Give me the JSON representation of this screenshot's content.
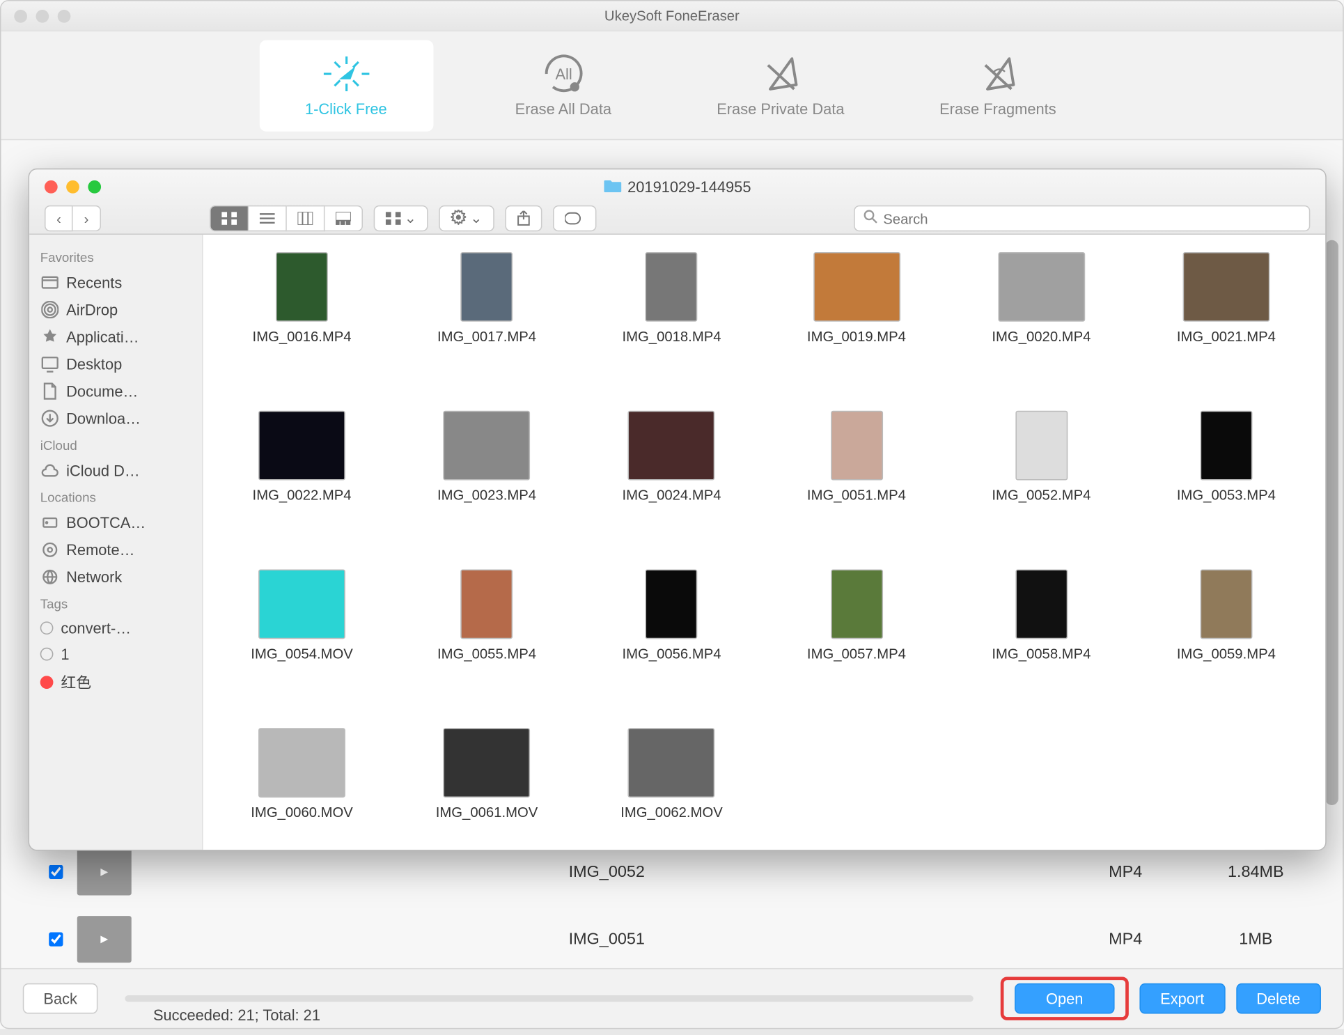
{
  "app": {
    "title": "UkeySoft FoneEraser",
    "tabs": [
      {
        "label": "1-Click Free",
        "active": true
      },
      {
        "label": "Erase All Data",
        "active": false
      },
      {
        "label": "Erase Private Data",
        "active": false
      },
      {
        "label": "Erase Fragments",
        "active": false
      }
    ]
  },
  "background_rows": [
    {
      "name": "IMG_0052",
      "type": "MP4",
      "size": "1.84MB"
    },
    {
      "name": "IMG_0051",
      "type": "MP4",
      "size": "1MB"
    }
  ],
  "bottom": {
    "back": "Back",
    "open": "Open",
    "export": "Export",
    "delete": "Delete",
    "status": "Succeeded: 21; Total: 21"
  },
  "finder": {
    "title": "20191029-144955",
    "search_placeholder": "Search",
    "sidebar": {
      "favorites": {
        "label": "Favorites",
        "items": [
          "Recents",
          "AirDrop",
          "Applicati…",
          "Desktop",
          "Docume…",
          "Downloa…"
        ]
      },
      "icloud": {
        "label": "iCloud",
        "items": [
          "iCloud D…"
        ]
      },
      "locations": {
        "label": "Locations",
        "items": [
          "BOOTCA…",
          "Remote…",
          "Network"
        ]
      },
      "tags": {
        "label": "Tags",
        "items": [
          "convert-…",
          "1",
          "红色"
        ]
      }
    },
    "files": [
      {
        "name": "IMG_0016.MP4",
        "t": "p",
        "bg": "#2d5a2d"
      },
      {
        "name": "IMG_0017.MP4",
        "t": "p",
        "bg": "#5a6a7a"
      },
      {
        "name": "IMG_0018.MP4",
        "t": "p",
        "bg": "#777"
      },
      {
        "name": "IMG_0019.MP4",
        "t": "l",
        "bg": "#c27a3a"
      },
      {
        "name": "IMG_0020.MP4",
        "t": "l",
        "bg": "#a0a0a0"
      },
      {
        "name": "IMG_0021.MP4",
        "t": "l",
        "bg": "#6e5a45"
      },
      {
        "name": "IMG_0022.MP4",
        "t": "l",
        "bg": "#0a0a15"
      },
      {
        "name": "IMG_0023.MP4",
        "t": "l",
        "bg": "#888"
      },
      {
        "name": "IMG_0024.MP4",
        "t": "l",
        "bg": "#4a2a2a"
      },
      {
        "name": "IMG_0051.MP4",
        "t": "p",
        "bg": "#caa89a"
      },
      {
        "name": "IMG_0052.MP4",
        "t": "p",
        "bg": "#ddd"
      },
      {
        "name": "IMG_0053.MP4",
        "t": "p",
        "bg": "#0a0a0a"
      },
      {
        "name": "IMG_0054.MOV",
        "t": "l",
        "bg": "#2ad4d4"
      },
      {
        "name": "IMG_0055.MP4",
        "t": "p",
        "bg": "#b56a4a"
      },
      {
        "name": "IMG_0056.MP4",
        "t": "p",
        "bg": "#0a0a0a"
      },
      {
        "name": "IMG_0057.MP4",
        "t": "p",
        "bg": "#5a7a3a"
      },
      {
        "name": "IMG_0058.MP4",
        "t": "p",
        "bg": "#111"
      },
      {
        "name": "IMG_0059.MP4",
        "t": "p",
        "bg": "#907a5a"
      },
      {
        "name": "IMG_0060.MOV",
        "t": "l",
        "bg": "#b8b8b8"
      },
      {
        "name": "IMG_0061.MOV",
        "t": "l",
        "bg": "#333"
      },
      {
        "name": "IMG_0062.MOV",
        "t": "l",
        "bg": "#666"
      }
    ]
  }
}
